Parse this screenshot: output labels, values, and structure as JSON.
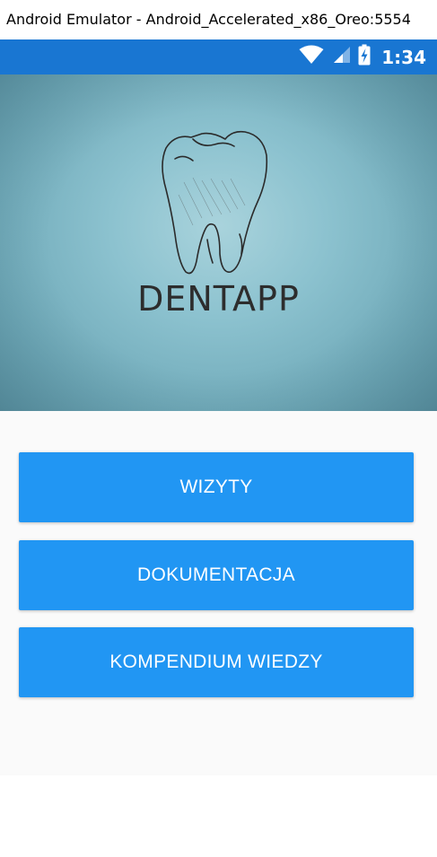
{
  "window": {
    "title": "Android Emulator - Android_Accelerated_x86_Oreo:5554"
  },
  "status_bar": {
    "time": "1:34",
    "icons": [
      "wifi-icon",
      "signal-icon",
      "battery-charging-icon"
    ],
    "background_color": "#1976d2"
  },
  "banner": {
    "logo_text": "DENTAPP",
    "logo_icon": "tooth-icon"
  },
  "menu": {
    "buttons": [
      {
        "label": "WIZYTY"
      },
      {
        "label": "DOKUMENTACJA"
      },
      {
        "label": "KOMPENDIUM WIEDZY"
      }
    ],
    "button_color": "#2196f3"
  }
}
